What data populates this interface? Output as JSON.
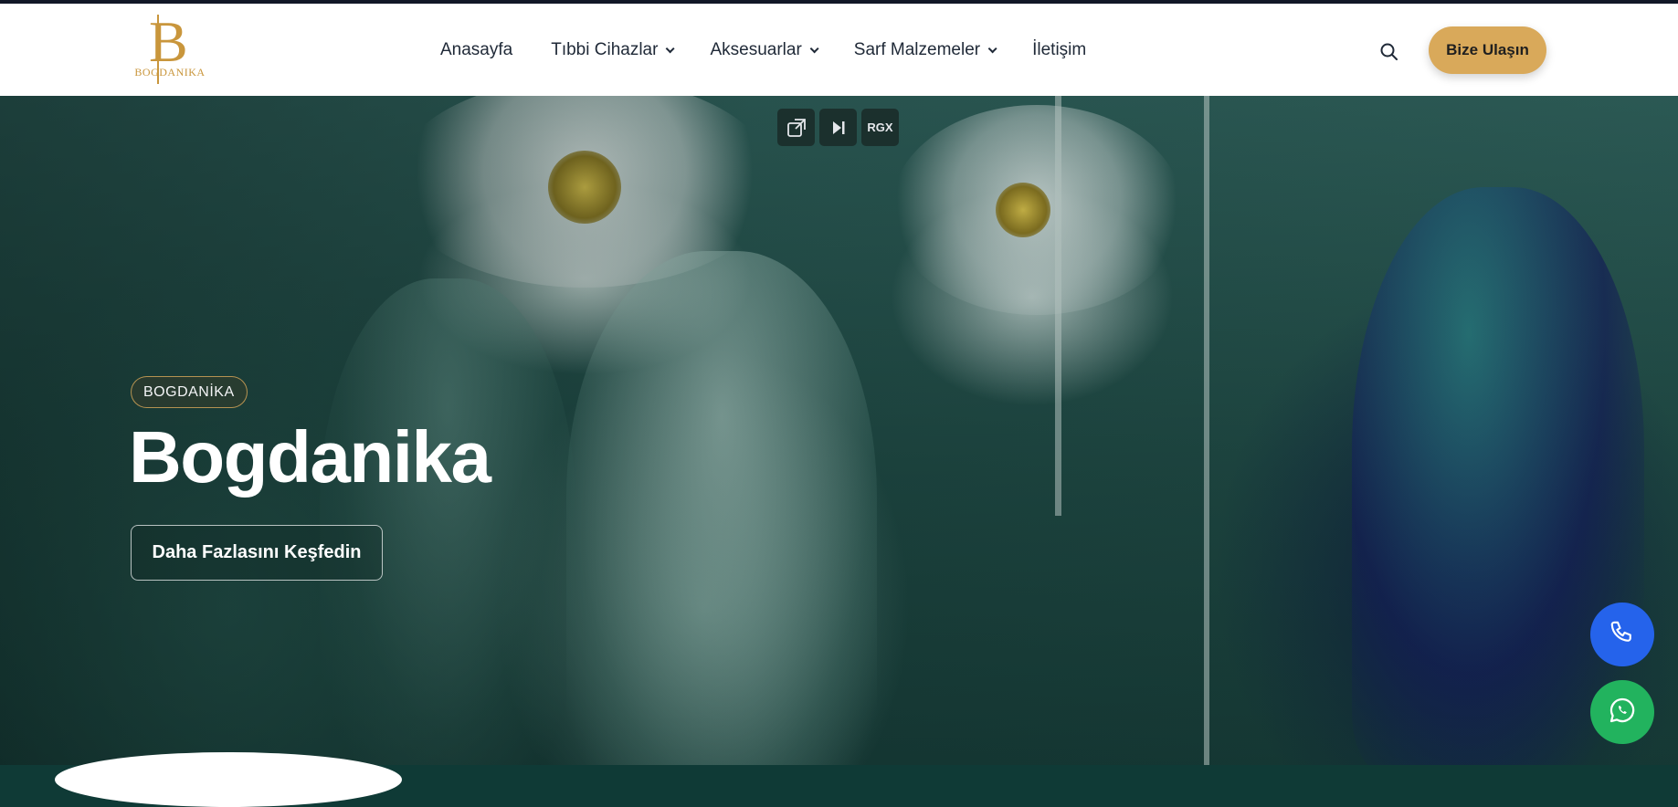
{
  "brand": {
    "logo_letter": "B",
    "logo_text": "BOGDANIKA",
    "color": "#c9963c"
  },
  "nav": {
    "items": [
      {
        "label": "Anasayfa",
        "has_dropdown": false
      },
      {
        "label": "Tıbbi Cihazlar",
        "has_dropdown": true
      },
      {
        "label": "Aksesuarlar",
        "has_dropdown": true
      },
      {
        "label": "Sarf Malzemeler",
        "has_dropdown": true
      },
      {
        "label": "İletişim",
        "has_dropdown": false
      }
    ],
    "search_icon": "search-icon",
    "cta_label": "Bize Ulaşın",
    "cta_color": "#d9a95a"
  },
  "hero": {
    "badge": "BOGDANİKA",
    "title": "Bogdanika",
    "button_label": "Daha Fazlasını Keşfedin"
  },
  "media_controls": {
    "icons": [
      "popout-icon",
      "skip-icon"
    ],
    "rgx_label": "RGX"
  },
  "floating": {
    "phone_icon": "phone-icon",
    "phone_color": "#2563eb",
    "whatsapp_icon": "whatsapp-icon",
    "whatsapp_color": "#22b35e"
  }
}
